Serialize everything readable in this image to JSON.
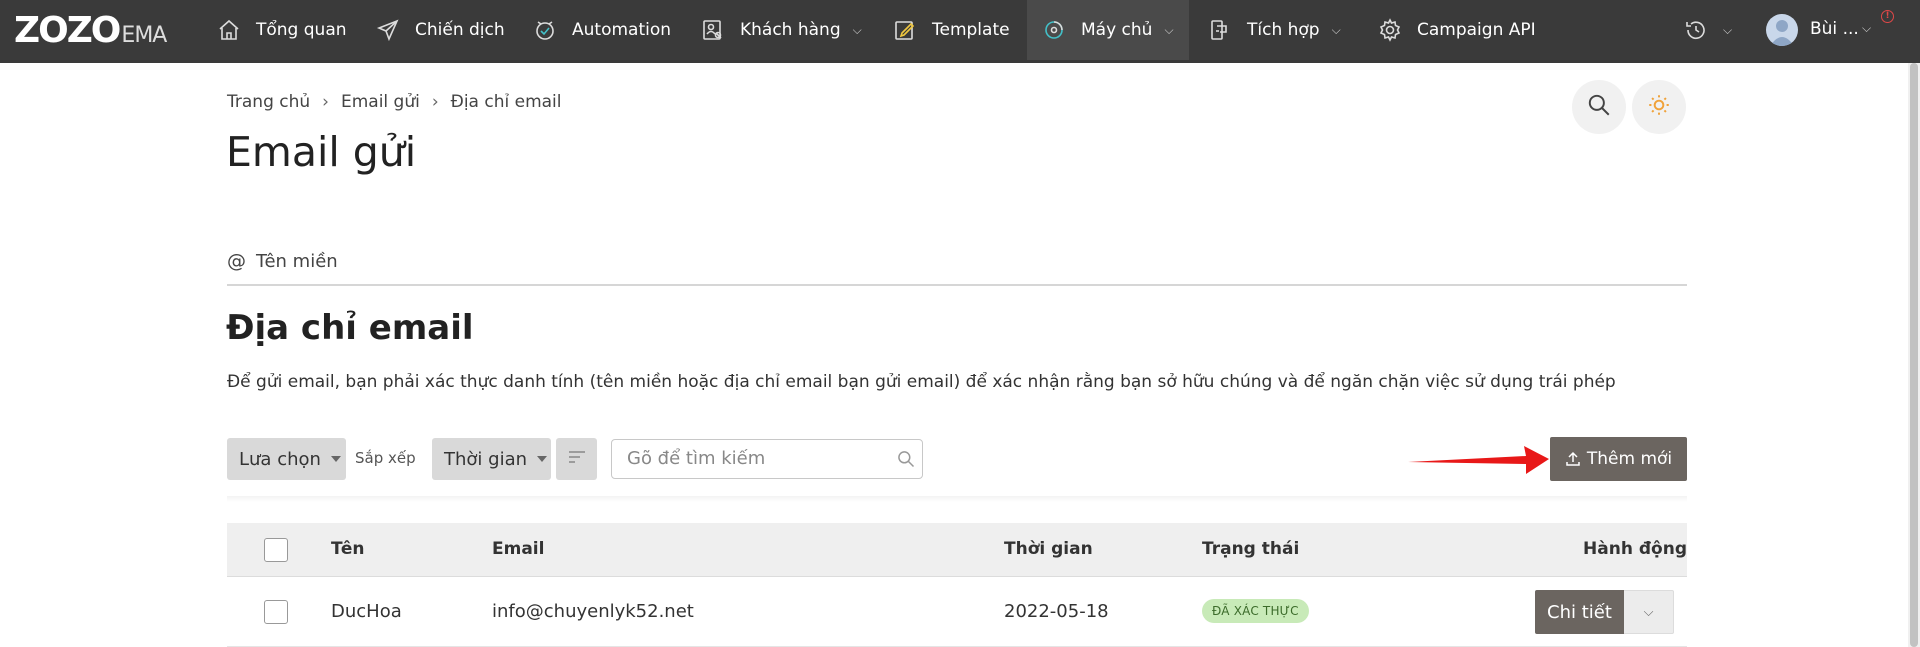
{
  "nav": {
    "logo": "ZOZO",
    "logo_sub": "EMA",
    "items": [
      {
        "label": "Tổng quan",
        "icon": "home-icon"
      },
      {
        "label": "Chiến dịch",
        "icon": "send-icon"
      },
      {
        "label": "Automation",
        "icon": "automation-icon"
      },
      {
        "label": "Khách hàng",
        "icon": "contacts-icon",
        "dropdown": true
      },
      {
        "label": "Template",
        "icon": "edit-icon"
      },
      {
        "label": "Máy chủ",
        "icon": "server-icon",
        "dropdown": true,
        "active": true
      },
      {
        "label": "Tích hợp",
        "icon": "integration-icon",
        "dropdown": true
      },
      {
        "label": "Campaign API",
        "icon": "gear-icon"
      }
    ],
    "user_name": "Bùi ...",
    "notify": "!"
  },
  "breadcrumb": [
    "Trang chủ",
    "Email gửi",
    "Địa chỉ email"
  ],
  "breadcrumb_sep": "›",
  "page_title": "Email gửi",
  "tab_domain": "Tên miền",
  "tab_at": "@",
  "section_title": "Địa chỉ email",
  "description": "Để gửi email, bạn phải xác thực danh tính (tên miền hoặc địa chỉ email bạn gửi email) để xác nhận rằng bạn sở hữu chúng và để ngăn chặn việc sử dụng trái phép",
  "toolbar": {
    "select_label": "Lưa chọn",
    "sort_label": "Sắp xếp",
    "sort_value": "Thời gian",
    "search_placeholder": "Gõ để tìm kiếm",
    "add_label": "Thêm mới"
  },
  "table": {
    "headers": {
      "name": "Tên",
      "email": "Email",
      "time": "Thời gian",
      "status": "Trạng thái",
      "action": "Hành động"
    },
    "rows": [
      {
        "name": "DucHoa",
        "email": "info@chuyenlyk52.net",
        "time": "2022-05-18",
        "status": "ĐÃ XÁC THỰC",
        "action": "Chi tiết"
      }
    ]
  },
  "colors": {
    "nav_bg": "#3a3a3a",
    "primary_button": "#6b6560",
    "verified_badge": "#c8eab8",
    "annotation_arrow": "#e81818",
    "sun_icon": "#f0a23a"
  }
}
